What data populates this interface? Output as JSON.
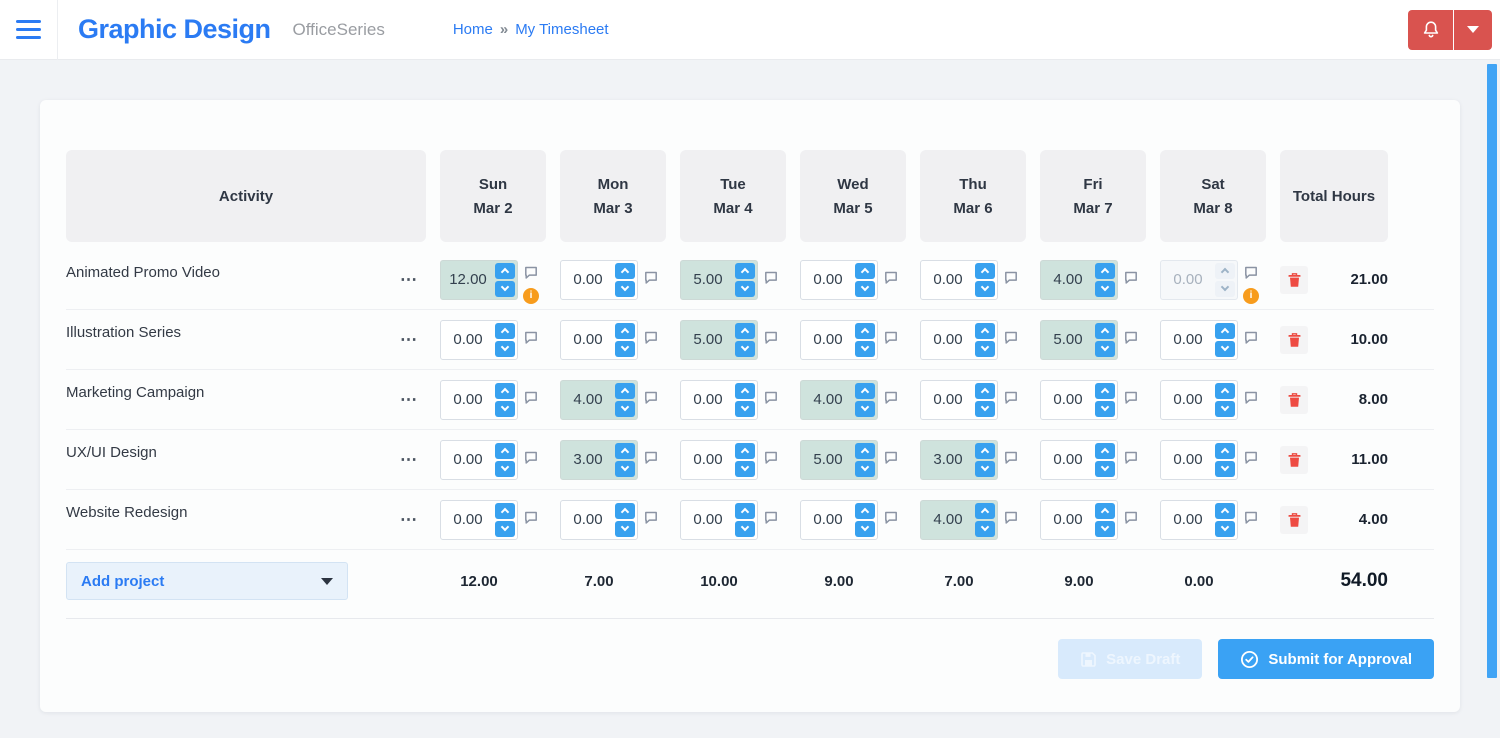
{
  "header": {
    "title": "Graphic Design",
    "app_name": "OfficeSeries",
    "breadcrumb": {
      "items": [
        "Home",
        "My Timesheet"
      ],
      "separator": "»"
    }
  },
  "timesheet": {
    "columns": {
      "activity": "Activity",
      "days": [
        {
          "day": "Sun",
          "date": "Mar 2"
        },
        {
          "day": "Mon",
          "date": "Mar 3"
        },
        {
          "day": "Tue",
          "date": "Mar 4"
        },
        {
          "day": "Wed",
          "date": "Mar 5"
        },
        {
          "day": "Thu",
          "date": "Mar 6"
        },
        {
          "day": "Fri",
          "date": "Mar 7"
        },
        {
          "day": "Sat",
          "date": "Mar 8"
        }
      ],
      "total": "Total Hours"
    },
    "rows": [
      {
        "activity": "Animated Promo Video",
        "cells": [
          {
            "value": "12.00",
            "highlighted": true,
            "warning": true
          },
          {
            "value": "0.00"
          },
          {
            "value": "5.00",
            "highlighted": true
          },
          {
            "value": "0.00"
          },
          {
            "value": "0.00"
          },
          {
            "value": "4.00",
            "highlighted": true
          },
          {
            "value": "0.00",
            "disabled": true,
            "warning": true
          }
        ],
        "total": "21.00"
      },
      {
        "activity": "Illustration Series",
        "cells": [
          {
            "value": "0.00"
          },
          {
            "value": "0.00"
          },
          {
            "value": "5.00",
            "highlighted": true
          },
          {
            "value": "0.00"
          },
          {
            "value": "0.00"
          },
          {
            "value": "5.00",
            "highlighted": true
          },
          {
            "value": "0.00"
          }
        ],
        "total": "10.00"
      },
      {
        "activity": "Marketing Campaign",
        "cells": [
          {
            "value": "0.00"
          },
          {
            "value": "4.00",
            "highlighted": true
          },
          {
            "value": "0.00"
          },
          {
            "value": "4.00",
            "highlighted": true
          },
          {
            "value": "0.00"
          },
          {
            "value": "0.00"
          },
          {
            "value": "0.00"
          }
        ],
        "total": "8.00"
      },
      {
        "activity": "UX/UI Design",
        "cells": [
          {
            "value": "0.00"
          },
          {
            "value": "3.00",
            "highlighted": true
          },
          {
            "value": "0.00"
          },
          {
            "value": "5.00",
            "highlighted": true
          },
          {
            "value": "3.00",
            "highlighted": true
          },
          {
            "value": "0.00"
          },
          {
            "value": "0.00"
          }
        ],
        "total": "11.00"
      },
      {
        "activity": "Website Redesign",
        "cells": [
          {
            "value": "0.00"
          },
          {
            "value": "0.00"
          },
          {
            "value": "0.00"
          },
          {
            "value": "0.00"
          },
          {
            "value": "4.00",
            "highlighted": true
          },
          {
            "value": "0.00"
          },
          {
            "value": "0.00"
          }
        ],
        "total": "4.00"
      }
    ],
    "footer": {
      "add_project_label": "Add project",
      "day_totals": [
        "12.00",
        "7.00",
        "10.00",
        "9.00",
        "7.00",
        "9.00",
        "0.00"
      ],
      "grand_total": "54.00"
    }
  },
  "actions": {
    "save_draft": "Save Draft",
    "submit": "Submit for Approval"
  },
  "icons": {
    "row_menu": "⋯",
    "warning_glyph": "i"
  },
  "colors": {
    "accent_blue": "#2b7bf3",
    "danger_red": "#d9534f",
    "spinner_blue": "#38a1ef",
    "highlight_cell": "#cfe3dd",
    "warning_orange": "#f79c1d",
    "trash_red": "#ee4b42",
    "submit_blue": "#3aa2f4",
    "scrollbar_blue": "#41a4f5"
  }
}
